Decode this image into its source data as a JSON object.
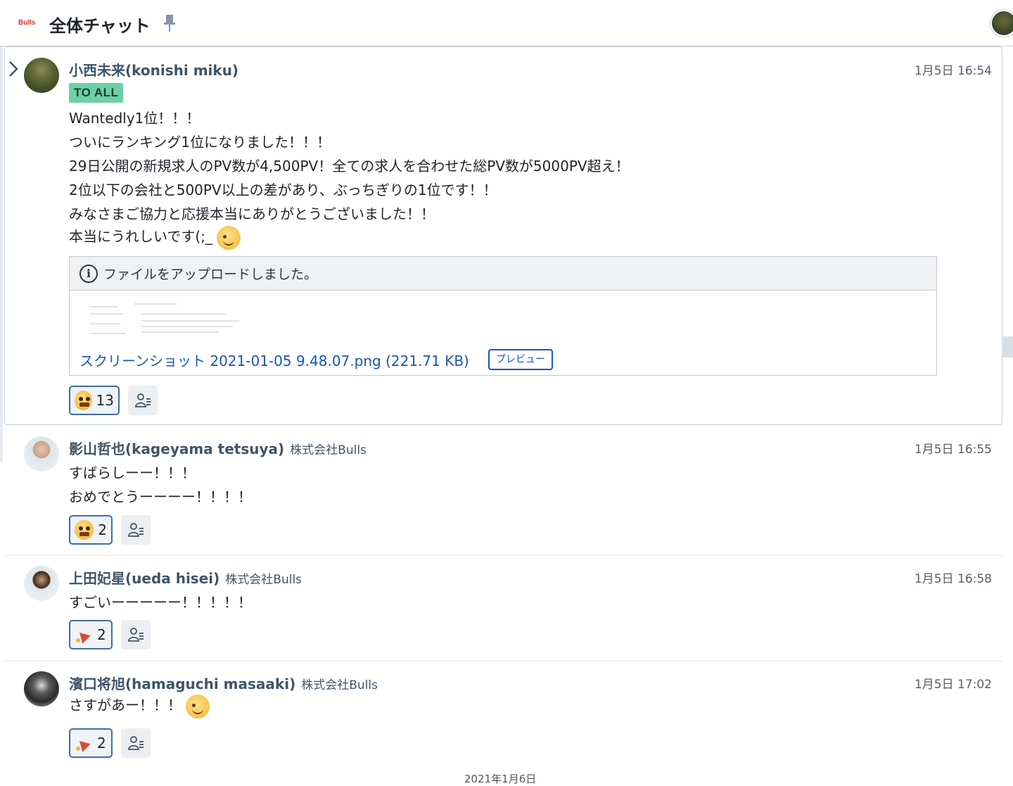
{
  "header": {
    "brand": "Bulls",
    "title": "全体チャット",
    "pin_icon": "pin-icon",
    "avatar_icon": "user-avatar"
  },
  "messages": [
    {
      "author": "小西未来(konishi miku)",
      "company": "",
      "time": "1月5日 16:54",
      "badge": "TO ALL",
      "lines": [
        "Wantedly1位！！！",
        "ついにランキング1位になりました！！！",
        "29日公開の新規求人のPV数が4,500PV！全ての求人を合わせた総PV数が5000PV超え！",
        "2位以下の会社と500PV以上の差があり、ぶっちぎりの1位です！！",
        "みなさまご協力と応援本当にありがとうございました！！",
        "本当にうれしいです(;_"
      ],
      "file": {
        "notice": "ファイルをアップロードしました。",
        "link_text": "スクリーンショット 2021-01-05 9.48.07.png (221.71 KB)",
        "preview_label": "プレビュー"
      },
      "reaction_count": "13"
    },
    {
      "author": "影山哲也(kageyama tetsuya)",
      "company": "株式会社Bulls",
      "time": "1月5日 16:55",
      "lines": [
        "すばらしーー！！！",
        "おめでとうーーーー！！！！"
      ],
      "reaction_count": "2"
    },
    {
      "author": "上田妃星(ueda hisei)",
      "company": "株式会社Bulls",
      "time": "1月5日 16:58",
      "lines": [
        "すごいーーーーー！！！！！"
      ],
      "reaction_count": "2"
    },
    {
      "author": "濱口将旭(hamaguchi masaaki)",
      "company": "株式会社Bulls",
      "time": "1月5日 17:02",
      "lines": [
        "さすがあー！！！"
      ],
      "reaction_count": "2"
    }
  ],
  "date_separator": "2021年1月6日",
  "colors": {
    "accent": "#3d5568",
    "badge": "#6ecfa6",
    "link": "#1a55b8",
    "brand": "#d0312d"
  }
}
